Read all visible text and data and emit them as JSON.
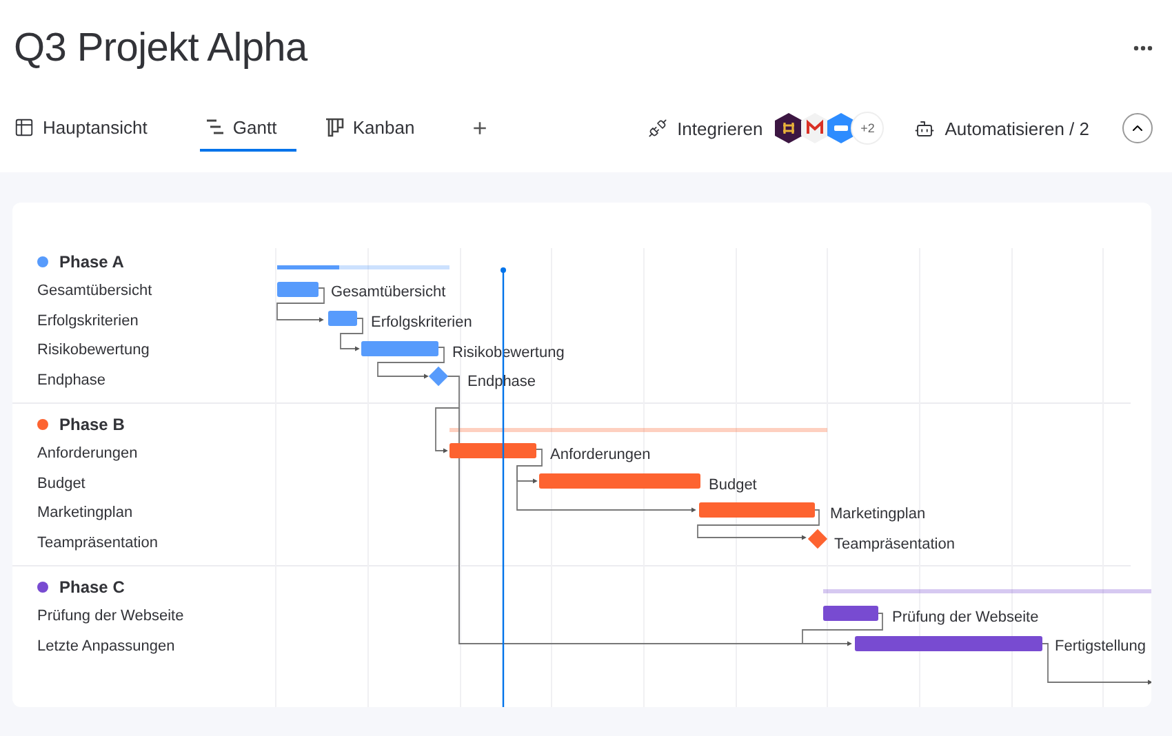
{
  "title": "Q3 Projekt Alpha",
  "views": [
    {
      "label": "Hauptansicht",
      "selected": false
    },
    {
      "label": "Gantt",
      "selected": true
    },
    {
      "label": "Kanban",
      "selected": false
    }
  ],
  "add_view": "+",
  "integrations": {
    "label": "Integrieren",
    "more": "+2"
  },
  "automations": {
    "label": "Automatisieren / 2"
  },
  "phases": [
    {
      "name": "Phase A",
      "color": "#579bfc",
      "level": 0.36,
      "tasks": [
        {
          "name": "Gesamtübersicht",
          "bar_label": "Gesamtübersicht",
          "kind": "bar"
        },
        {
          "name": "Erfolgskriterien",
          "bar_label": "Erfolgskriterien",
          "kind": "bar"
        },
        {
          "name": "Risikobewertung",
          "bar_label": "Risikobewertung",
          "kind": "bar"
        },
        {
          "name": "Endphase",
          "bar_label": "Endphase",
          "kind": "milestone"
        }
      ]
    },
    {
      "name": "Phase B",
      "color": "#fd6330",
      "tasks": [
        {
          "name": "Anforderungen",
          "bar_label": "Anforderungen",
          "kind": "bar"
        },
        {
          "name": "Budget",
          "bar_label": "Budget",
          "kind": "bar"
        },
        {
          "name": "Marketingplan",
          "bar_label": "Marketingplan",
          "kind": "bar"
        },
        {
          "name": "Teampräsentation",
          "bar_label": "Teampräsentation",
          "kind": "milestone"
        }
      ]
    },
    {
      "name": "Phase C",
      "color": "#784bd1",
      "tasks": [
        {
          "name": "Prüfung der Webseite",
          "bar_label": "Prüfung der Webseite",
          "kind": "bar"
        },
        {
          "name": "Letzte Anpassungen",
          "bar_label": "Fertigstellung",
          "kind": "bar"
        }
      ]
    }
  ]
}
